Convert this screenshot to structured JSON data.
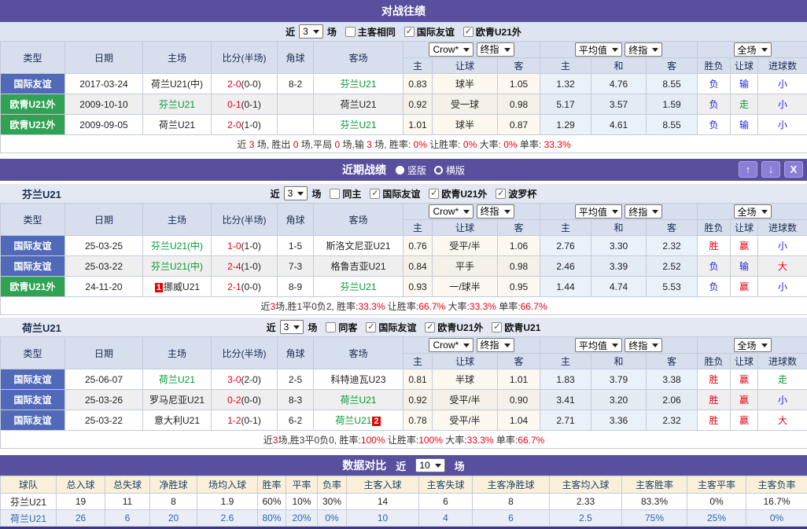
{
  "colors": {
    "accent_purple": "#58509E",
    "window_button_purple": "#8780D5",
    "table_header_bg": "#D7DFEF",
    "filter_bar_bg": "#DEE5F1",
    "odds_cream_bg": "#FCF7EF",
    "avg_lightblue_bg": "#EAF2F9",
    "league_blue": "#5169B9",
    "league_green": "#2FA353",
    "team_green": "#009933",
    "red": "#E60012",
    "blue": "#2121DF",
    "comparison_header_bg": "#FAF0DA",
    "comparison_header_text": "#1E4166",
    "comparison_highlight_text": "#2E63B0"
  },
  "shared_head": {
    "cols": [
      "类型",
      "日期",
      "主场",
      "比分(半场)",
      "角球",
      "客场"
    ],
    "sub": [
      "主",
      "让球",
      "客",
      "主",
      "和",
      "客",
      "胜负",
      "让球",
      "进球数"
    ],
    "selects": {
      "book": "Crow*",
      "final_a": "终指",
      "avg": "平均值",
      "final_b": "终指",
      "scope": "全场"
    }
  },
  "h2h": {
    "title": "对战往绩",
    "filter": {
      "near": "近",
      "games": "3",
      "unit": "场",
      "checks": [
        {
          "label": "主客相同",
          "checked": false
        },
        {
          "label": "国际友谊",
          "checked": true
        },
        {
          "label": "欧青U21外",
          "checked": true
        }
      ]
    },
    "rows": [
      {
        "league": {
          "label": "国际友谊",
          "color": "blue"
        },
        "date": "2017-03-24",
        "home": {
          "name": "荷兰U21(中)"
        },
        "score": "2-0",
        "half": "(0-0)",
        "corner": "8-2",
        "away": {
          "name": "芬兰U21",
          "green": true
        },
        "odds": [
          "0.83",
          "球半",
          "1.05"
        ],
        "avg": [
          "1.32",
          "4.76",
          "8.55"
        ],
        "results": [
          {
            "t": "负",
            "c": "t-blue"
          },
          {
            "t": "输",
            "c": "t-blue"
          },
          {
            "t": "小",
            "c": "t-blue"
          }
        ]
      },
      {
        "league": {
          "label": "欧青U21外",
          "color": "green"
        },
        "date": "2009-10-10",
        "home": {
          "name": "芬兰U21",
          "green": true
        },
        "score": "0-1",
        "half": "(0-1)",
        "corner": "",
        "away": {
          "name": "荷兰U21"
        },
        "odds": [
          "0.92",
          "受一球",
          "0.98"
        ],
        "avg": [
          "5.17",
          "3.57",
          "1.59"
        ],
        "results": [
          {
            "t": "负",
            "c": "t-blue"
          },
          {
            "t": "走",
            "c": "t-green"
          },
          {
            "t": "小",
            "c": "t-blue"
          }
        ]
      },
      {
        "league": {
          "label": "欧青U21外",
          "color": "green"
        },
        "date": "2009-09-05",
        "home": {
          "name": "荷兰U21"
        },
        "score": "2-0",
        "half": "(1-0)",
        "corner": "",
        "away": {
          "name": "芬兰U21",
          "green": true
        },
        "odds": [
          "1.01",
          "球半",
          "0.87"
        ],
        "avg": [
          "1.29",
          "4.61",
          "8.55"
        ],
        "results": [
          {
            "t": "负",
            "c": "t-blue"
          },
          {
            "t": "输",
            "c": "t-blue"
          },
          {
            "t": "小",
            "c": "t-blue"
          }
        ]
      }
    ],
    "summary": [
      {
        "t": "近 "
      },
      {
        "t": "3",
        "c": "t-red"
      },
      {
        "t": " 场, 胜出 "
      },
      {
        "t": "0",
        "c": "t-red"
      },
      {
        "t": " 场,平局 "
      },
      {
        "t": "0",
        "c": "t-red"
      },
      {
        "t": " 场,输 "
      },
      {
        "t": "3",
        "c": "t-red"
      },
      {
        "t": " 场, 胜率: "
      },
      {
        "t": "0%",
        "c": "t-red"
      },
      {
        "t": " 让胜率: "
      },
      {
        "t": "0%",
        "c": "t-red"
      },
      {
        "t": " 大率: "
      },
      {
        "t": "0%",
        "c": "t-red"
      },
      {
        "t": " 单率: "
      },
      {
        "t": "33.3%",
        "c": "t-red"
      }
    ]
  },
  "recent": {
    "title": "近期战绩",
    "radios": [
      {
        "label": "竖版",
        "selected": true
      },
      {
        "label": "横版",
        "selected": false
      }
    ],
    "window_buttons": [
      {
        "icon": "arrow-up-icon",
        "glyph": "↑"
      },
      {
        "icon": "arrow-down-icon",
        "glyph": "↓"
      },
      {
        "icon": "close-icon",
        "glyph": "X"
      }
    ],
    "sections": [
      {
        "team": "芬兰U21",
        "filter": {
          "near": "近",
          "games": "3",
          "unit": "场",
          "checks": [
            {
              "label": "同主",
              "checked": false
            },
            {
              "label": "国际友谊",
              "checked": true
            },
            {
              "label": "欧青U21外",
              "checked": true
            },
            {
              "label": "波罗杯",
              "checked": true
            }
          ]
        },
        "rows": [
          {
            "league": {
              "label": "国际友谊",
              "color": "blue"
            },
            "date": "25-03-25",
            "home": {
              "name": "芬兰U21(中)",
              "green": true
            },
            "score": "1-0",
            "half": "(1-0)",
            "corner": "1-5",
            "away": {
              "name": "斯洛文尼亚U21"
            },
            "odds": [
              "0.76",
              "受平/半",
              "1.06"
            ],
            "avg": [
              "2.76",
              "3.30",
              "2.32"
            ],
            "results": [
              {
                "t": "胜",
                "c": "t-red"
              },
              {
                "t": "赢",
                "c": "t-red"
              },
              {
                "t": "小",
                "c": "t-blue"
              }
            ]
          },
          {
            "league": {
              "label": "国际友谊",
              "color": "blue"
            },
            "date": "25-03-22",
            "home": {
              "name": "芬兰U21(中)",
              "green": true
            },
            "score": "2-4",
            "half": "(1-0)",
            "corner": "7-3",
            "away": {
              "name": "格鲁吉亚U21"
            },
            "odds": [
              "0.84",
              "平手",
              "0.98"
            ],
            "avg": [
              "2.46",
              "3.39",
              "2.52"
            ],
            "results": [
              {
                "t": "负",
                "c": "t-blue"
              },
              {
                "t": "输",
                "c": "t-blue"
              },
              {
                "t": "大",
                "c": "t-red"
              }
            ]
          },
          {
            "league": {
              "label": "欧青U21外",
              "color": "green"
            },
            "date": "24-11-20",
            "home": {
              "name": "挪威U21",
              "badge_before": "1"
            },
            "score": "2-1",
            "half": "(0-0)",
            "corner": "8-9",
            "away": {
              "name": "芬兰U21",
              "green": true
            },
            "odds": [
              "0.93",
              "一/球半",
              "0.95"
            ],
            "avg": [
              "1.44",
              "4.74",
              "5.53"
            ],
            "results": [
              {
                "t": "负",
                "c": "t-blue"
              },
              {
                "t": "赢",
                "c": "t-red"
              },
              {
                "t": "小",
                "c": "t-blue"
              }
            ]
          }
        ],
        "summary": [
          {
            "t": "近"
          },
          {
            "t": "3",
            "c": "t-red"
          },
          {
            "t": "场,胜1平0负2, 胜率:"
          },
          {
            "t": "33.3%",
            "c": "t-red"
          },
          {
            "t": " 让胜率:"
          },
          {
            "t": "66.7%",
            "c": "t-red"
          },
          {
            "t": " 大率:"
          },
          {
            "t": "33.3%",
            "c": "t-red"
          },
          {
            "t": " 单率:"
          },
          {
            "t": "66.7%",
            "c": "t-red"
          }
        ]
      },
      {
        "team": "荷兰U21",
        "filter": {
          "near": "近",
          "games": "3",
          "unit": "场",
          "checks": [
            {
              "label": "同客",
              "checked": false
            },
            {
              "label": "国际友谊",
              "checked": true
            },
            {
              "label": "欧青U21外",
              "checked": true
            },
            {
              "label": "欧青U21",
              "checked": true
            }
          ]
        },
        "rows": [
          {
            "league": {
              "label": "国际友谊",
              "color": "blue"
            },
            "date": "25-06-07",
            "home": {
              "name": "荷兰U21",
              "green": true
            },
            "score": "3-0",
            "half": "(2-0)",
            "corner": "2-5",
            "away": {
              "name": "科特迪瓦U23"
            },
            "odds": [
              "0.81",
              "半球",
              "1.01"
            ],
            "avg": [
              "1.83",
              "3.79",
              "3.38"
            ],
            "results": [
              {
                "t": "胜",
                "c": "t-red"
              },
              {
                "t": "赢",
                "c": "t-red"
              },
              {
                "t": "走",
                "c": "t-green"
              }
            ]
          },
          {
            "league": {
              "label": "国际友谊",
              "color": "blue"
            },
            "date": "25-03-26",
            "home": {
              "name": "罗马尼亚U21"
            },
            "score": "0-2",
            "half": "(0-0)",
            "corner": "8-3",
            "away": {
              "name": "荷兰U21",
              "green": true
            },
            "odds": [
              "0.92",
              "受平/半",
              "0.90"
            ],
            "avg": [
              "3.41",
              "3.20",
              "2.06"
            ],
            "results": [
              {
                "t": "胜",
                "c": "t-red"
              },
              {
                "t": "赢",
                "c": "t-red"
              },
              {
                "t": "小",
                "c": "t-blue"
              }
            ]
          },
          {
            "league": {
              "label": "国际友谊",
              "color": "blue"
            },
            "date": "25-03-22",
            "home": {
              "name": "意大利U21"
            },
            "score": "1-2",
            "half": "(0-1)",
            "corner": "6-2",
            "away": {
              "name": "荷兰U21",
              "green": true,
              "badge_after": "2"
            },
            "odds": [
              "0.78",
              "受平/半",
              "1.04"
            ],
            "avg": [
              "2.71",
              "3.36",
              "2.32"
            ],
            "results": [
              {
                "t": "胜",
                "c": "t-red"
              },
              {
                "t": "赢",
                "c": "t-red"
              },
              {
                "t": "大",
                "c": "t-red"
              }
            ]
          }
        ],
        "summary": [
          {
            "t": "近"
          },
          {
            "t": "3",
            "c": "t-red"
          },
          {
            "t": "场,胜3平0负0, 胜率:"
          },
          {
            "t": "100%",
            "c": "t-red"
          },
          {
            "t": " 让胜率:"
          },
          {
            "t": "100%",
            "c": "t-red"
          },
          {
            "t": " 大率:"
          },
          {
            "t": "33.3%",
            "c": "t-red"
          },
          {
            "t": " 单率:"
          },
          {
            "t": "66.7%",
            "c": "t-red"
          }
        ]
      }
    ]
  },
  "comparison": {
    "title": "数据对比",
    "near": "近",
    "games": "10",
    "unit": "场",
    "columns": [
      "球队",
      "总入球",
      "总失球",
      "净胜球",
      "场均入球",
      "胜率",
      "平率",
      "负率",
      "主客入球",
      "主客失球",
      "主客净胜球",
      "主客均入球",
      "主客胜率",
      "主客平率",
      "主客负率"
    ],
    "rows": [
      {
        "team": "芬兰U21",
        "highlight": false,
        "values": [
          "19",
          "11",
          "8",
          "1.9",
          "60%",
          "10%",
          "30%",
          "14",
          "6",
          "8",
          "2.33",
          "83.3%",
          "0%",
          "16.7%"
        ]
      },
      {
        "team": "荷兰U21",
        "highlight": true,
        "values": [
          "26",
          "6",
          "20",
          "2.6",
          "80%",
          "20%",
          "0%",
          "10",
          "4",
          "6",
          "2.5",
          "75%",
          "25%",
          "0%"
        ]
      }
    ]
  }
}
